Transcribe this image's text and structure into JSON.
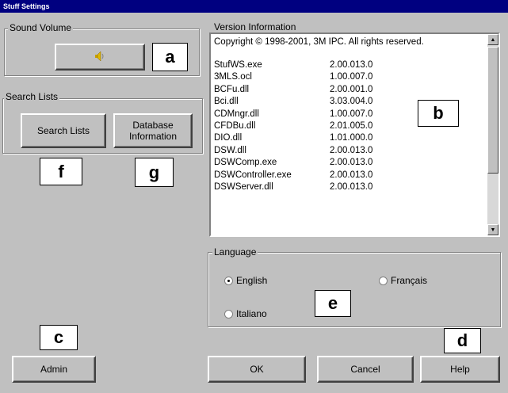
{
  "window": {
    "title": "Stuff Settings"
  },
  "sound": {
    "label": "Sound Volume",
    "icon": "speaker-icon"
  },
  "search": {
    "label": "Search Lists",
    "search_lists_button": "Search Lists",
    "database_button_line1": "Database",
    "database_button_line2": "Information"
  },
  "version": {
    "label": "Version Information",
    "copyright": "Copyright © 1998-2001, 3M IPC.  All rights reserved.",
    "files": [
      {
        "name": "StufWS.exe",
        "version": "2.00.013.0"
      },
      {
        "name": "3MLS.ocl",
        "version": "1.00.007.0"
      },
      {
        "name": "BCFu.dll",
        "version": "2.00.001.0"
      },
      {
        "name": "Bci.dll",
        "version": "3.03.004.0"
      },
      {
        "name": "CDMngr.dll",
        "version": "1.00.007.0"
      },
      {
        "name": "CFDBu.dll",
        "version": "2.01.005.0"
      },
      {
        "name": "DIO.dll",
        "version": "1.01.000.0"
      },
      {
        "name": "DSW.dll",
        "version": "2.00.013.0"
      },
      {
        "name": "DSWComp.exe",
        "version": "2.00.013.0"
      },
      {
        "name": "DSWController.exe",
        "version": "2.00.013.0"
      },
      {
        "name": "DSWServer.dll",
        "version": "2.00.013.0"
      }
    ]
  },
  "language": {
    "label": "Language",
    "options": [
      "English",
      "Français",
      "Italiano"
    ],
    "selected": "English"
  },
  "buttons": {
    "admin": "Admin",
    "ok": "OK",
    "cancel": "Cancel",
    "help": "Help"
  },
  "callouts": {
    "a": "a",
    "b": "b",
    "c": "c",
    "d": "d",
    "e": "e",
    "f": "f",
    "g": "g"
  }
}
